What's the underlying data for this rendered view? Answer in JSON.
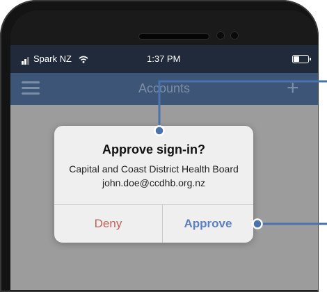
{
  "status_bar": {
    "carrier": "Spark NZ",
    "time": "1:37 PM"
  },
  "nav": {
    "title": "Accounts",
    "add_symbol": "+"
  },
  "dialog": {
    "title": "Approve sign-in?",
    "organization": "Capital and Coast District Health Board",
    "account": "john.doe@ccdhb.org.nz",
    "deny_label": "Deny",
    "approve_label": "Approve"
  },
  "icons": [
    "signal-icon",
    "wifi-icon",
    "battery-icon",
    "menu-icon",
    "add-icon"
  ],
  "colors": {
    "nav_bar": "#3d5677",
    "status_bar": "#212a3a",
    "deny_text": "#c0625c",
    "approve_text": "#5b7fc0",
    "callout": "#4a72ac"
  }
}
